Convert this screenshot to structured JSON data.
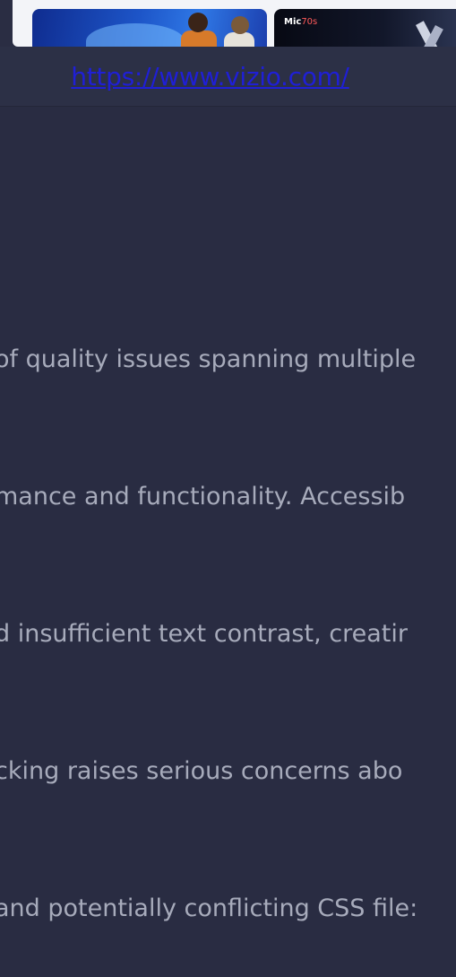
{
  "thumbnails": [
    {
      "name": "sports-promo",
      "label": ""
    },
    {
      "name": "mic-promo",
      "label_main": "Mic",
      "label_accent": "70s"
    }
  ],
  "url_bar": {
    "link_text": "https://www.vizio.com/"
  },
  "description_lines": [
    "of quality issues spanning multiple",
    "mance and functionality. Accessib",
    "d insufficient text contrast, creatir",
    "cking raises serious concerns abo",
    "and potentially conflicting CSS file:"
  ],
  "colors": {
    "background": "#292c42",
    "text": "#a7abbb",
    "link": "#1f1fd6"
  }
}
